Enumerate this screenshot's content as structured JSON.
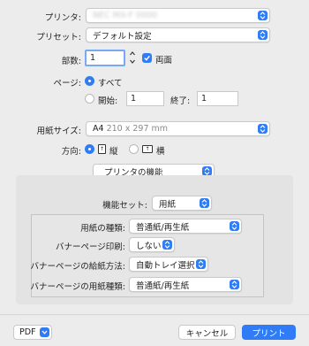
{
  "printer": {
    "label": "プリンタ:",
    "value": "NEC MX-F 0000"
  },
  "presets": {
    "label": "プリセット:",
    "value": "デフォルト設定"
  },
  "copies": {
    "label": "部数:",
    "value": "1",
    "duplex_label": "両面"
  },
  "pages": {
    "label": "ページ:",
    "all_label": "すべて",
    "from_label": "開始:",
    "from_value": "1",
    "to_label": "終了:",
    "to_value": "1"
  },
  "paper_size": {
    "label": "用紙サイズ:",
    "value": "A4",
    "dimensions": "210 x 297 mm"
  },
  "orientation": {
    "label": "方向:",
    "portrait_label": "縦",
    "landscape_label": "横"
  },
  "section_popup": {
    "value": "プリンタの機能"
  },
  "feature_set": {
    "label": "機能セット:",
    "value": "用紙"
  },
  "features": [
    {
      "label": "用紙の種類:",
      "value": "普通紙/再生紙"
    },
    {
      "label": "バナーページ印刷:",
      "value": "しない"
    },
    {
      "label": "バナーページの給紙方法:",
      "value": "自動トレイ選択"
    },
    {
      "label": "バナーページの用紙種類:",
      "value": "普通紙/再生紙"
    }
  ],
  "footer": {
    "pdf_label": "PDF",
    "cancel_label": "キャンセル",
    "print_label": "プリント"
  },
  "colors": {
    "accent": "#2f7cf6",
    "background": "#ececec"
  }
}
